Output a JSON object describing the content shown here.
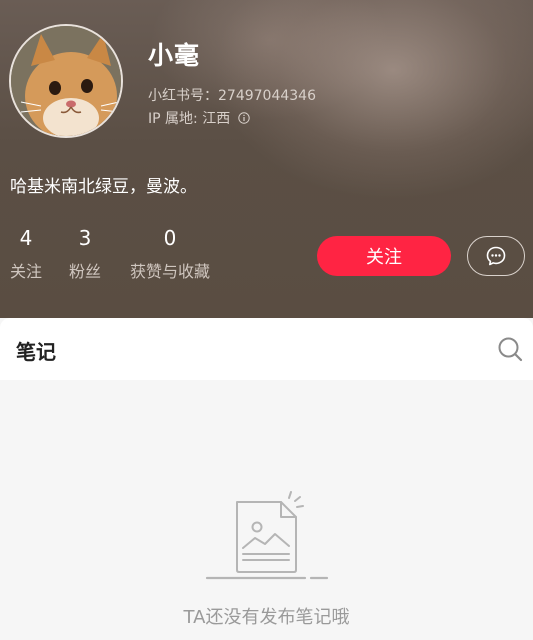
{
  "profile": {
    "name": "小毫",
    "id_line": "小红书号：27497044346",
    "ip_line": "IP 属地: 江西",
    "bio": "哈基米南北绿豆，曼波。"
  },
  "stats": [
    {
      "value": "4",
      "label": "关注"
    },
    {
      "value": "3",
      "label": "粉丝"
    },
    {
      "value": "0",
      "label": "获赞与收藏"
    }
  ],
  "actions": {
    "follow_label": "关注"
  },
  "notes": {
    "tab_label": "笔记",
    "empty_text": "TA还没有发布笔记哦"
  },
  "colors": {
    "accent": "#ff2443",
    "header_bg": "#5b4f45"
  },
  "icons": {
    "info": "info-icon",
    "message": "chat-bubble-icon",
    "search": "search-icon",
    "empty": "empty-document-icon"
  }
}
